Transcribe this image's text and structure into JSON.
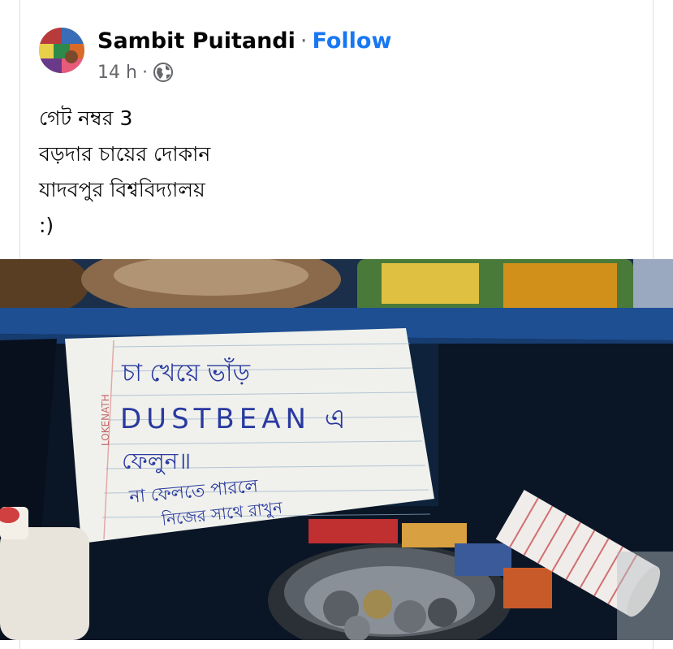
{
  "post": {
    "author": "Sambit Puitandi",
    "separator": "·",
    "follow_label": "Follow",
    "time": "14 h",
    "privacy_icon": "globe-icon",
    "lines": [
      "গেট নম্বর 3",
      "বড়দার চায়ের দোকান",
      "যাদবপুর বিশ্ববিদ্যালয়",
      ":)"
    ]
  },
  "photo": {
    "note_brand": "LOKENATH",
    "note_line1": "চা খেয়ে ভাঁড়",
    "note_line2": "DUSTBEAN এ",
    "note_line3": "ফেলুন॥",
    "note_line4": "না ফেলতে পারলে",
    "note_line5": "নিজের সাথে রাখুন"
  },
  "colors": {
    "link": "#1877f2",
    "secondary_text": "#65676b",
    "shelf_blue": "#1e4f93"
  }
}
